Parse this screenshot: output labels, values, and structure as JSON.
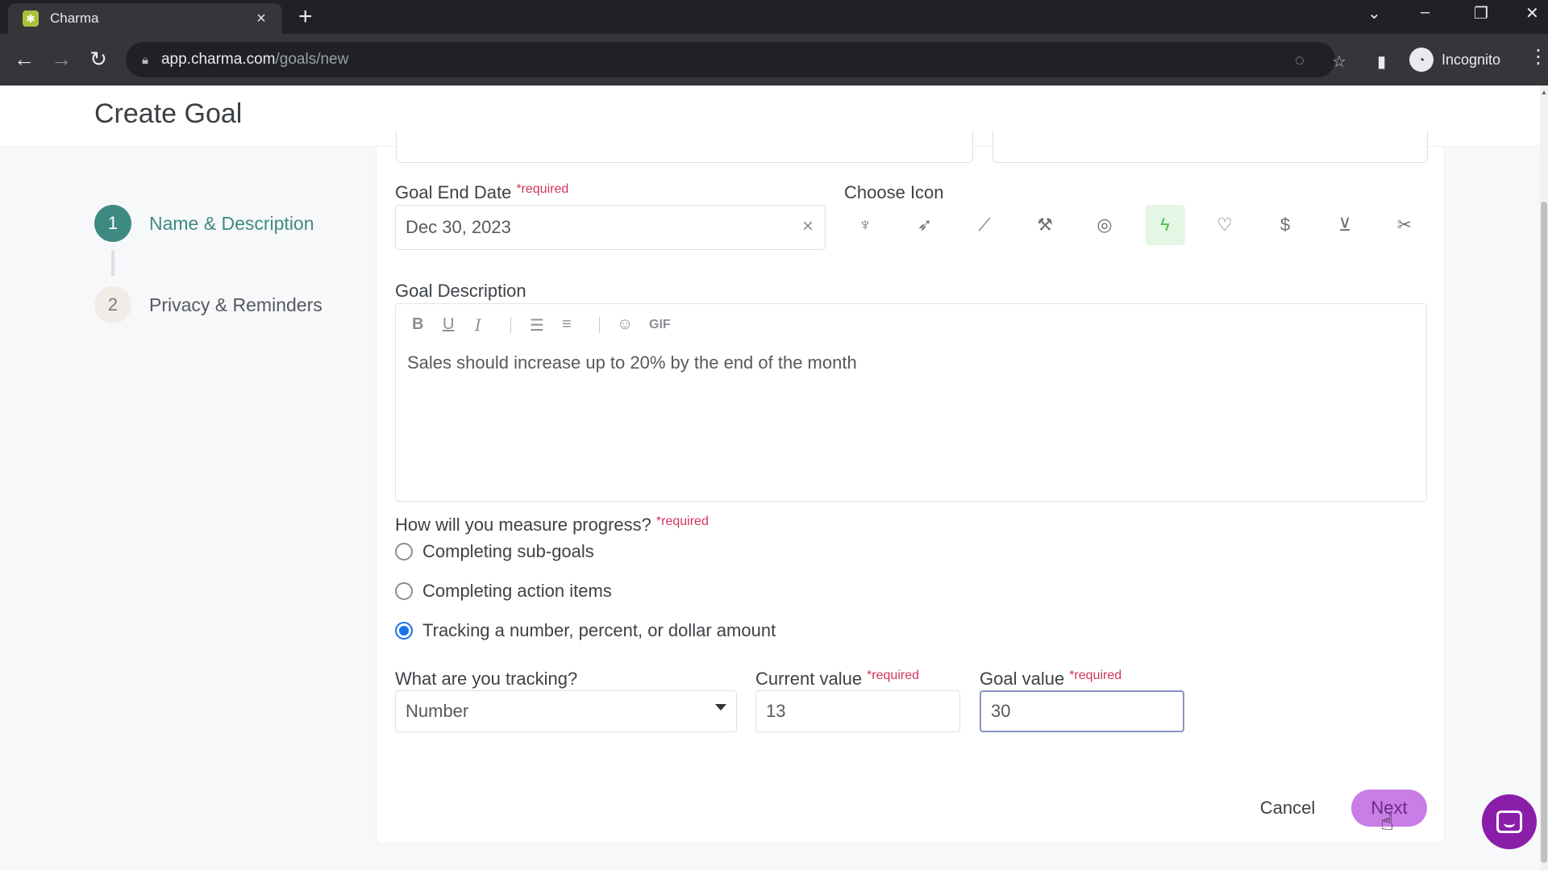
{
  "browser": {
    "tab_title": "Charma",
    "tab_favicon": "charma-logo-icon",
    "url_host": "app.charma.com",
    "url_path": "/goals/new",
    "profile_label": "Incognito"
  },
  "page": {
    "title": "Create Goal"
  },
  "stepper": {
    "steps": [
      {
        "number": "1",
        "label": "Name & Description",
        "state": "active"
      },
      {
        "number": "2",
        "label": "Privacy & Reminders",
        "state": "inactive"
      }
    ]
  },
  "form": {
    "end_date": {
      "label": "Goal End Date",
      "required": "*required",
      "value": "Dec 30, 2023"
    },
    "choose_icon": {
      "label": "Choose Icon",
      "icons": [
        "trophy-icon",
        "rocket-icon",
        "telescope-icon",
        "hammer-icon",
        "apple-icon",
        "lightning-icon",
        "heart-icon",
        "dollar-coin-icon",
        "podium-icon",
        "scissors-icon"
      ],
      "selected_index": 5,
      "selected_color": "#4bbf4b"
    },
    "description": {
      "label": "Goal Description",
      "toolbar": [
        "bold-icon",
        "underline-icon",
        "italic-icon",
        "bullet-list-icon",
        "numbered-list-icon",
        "emoji-icon"
      ],
      "gif_label": "GIF",
      "value": "Sales should increase up to 20% by the end of the month"
    },
    "measure": {
      "label": "How will you measure progress?",
      "required": "*required",
      "options": [
        {
          "label": "Completing sub-goals",
          "checked": false
        },
        {
          "label": "Completing action items",
          "checked": false
        },
        {
          "label": "Tracking a number, percent, or dollar amount",
          "checked": true
        }
      ]
    },
    "tracking": {
      "label": "What are you tracking?",
      "value": "Number"
    },
    "current_value": {
      "label": "Current value",
      "required": "*required",
      "value": "13"
    },
    "goal_value": {
      "label": "Goal value",
      "required": "*required",
      "value": "30"
    }
  },
  "actions": {
    "cancel": "Cancel",
    "next": "Next"
  },
  "colors": {
    "accent_teal": "#3e8a83",
    "required_red": "#d0355b",
    "next_button": "#c97de6",
    "chat_bubble": "#8b1ea8"
  }
}
